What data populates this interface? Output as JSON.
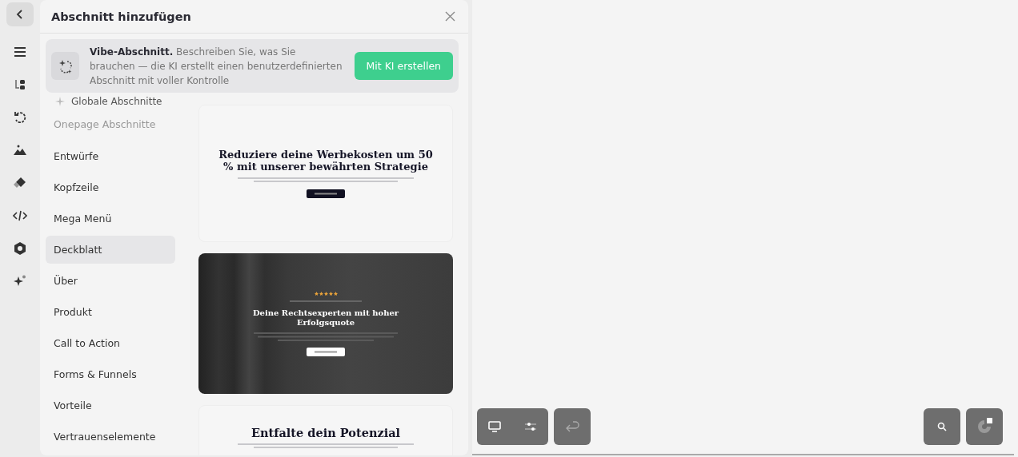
{
  "panel": {
    "title": "Abschnitt hinzufügen"
  },
  "vibe_banner": {
    "title": "Vibe-Abschnitt.",
    "text": "Beschreiben Sie, was Sie brauchen — die KI erstellt einen benutzerdefinierten Abschnitt mit voller Kontrolle",
    "button": "Mit KI erstellen"
  },
  "global_item": "Globale Abschnitte",
  "section_heading": "Onepage Abschnitte",
  "categories": [
    {
      "label": "Entwürfe",
      "selected": false
    },
    {
      "label": "Kopfzeile",
      "selected": false
    },
    {
      "label": "Mega Menü",
      "selected": false
    },
    {
      "label": "Deckblatt",
      "selected": true
    },
    {
      "label": "Über",
      "selected": false
    },
    {
      "label": "Produkt",
      "selected": false
    },
    {
      "label": "Call to Action",
      "selected": false
    },
    {
      "label": "Forms & Funnels",
      "selected": false
    },
    {
      "label": "Vorteile",
      "selected": false
    },
    {
      "label": "Vertrauenselemente",
      "selected": false
    }
  ],
  "previews": [
    {
      "kind": "light",
      "heading": "Reduziere deine Werbekosten um 50 % mit unserer bewährten Strategie"
    },
    {
      "kind": "photo",
      "stars": 5,
      "heading": "Deine Rechtsexperten mit hoher Erfolgsquote"
    },
    {
      "kind": "light",
      "heading": "Entfalte dein Potenzial"
    }
  ]
}
